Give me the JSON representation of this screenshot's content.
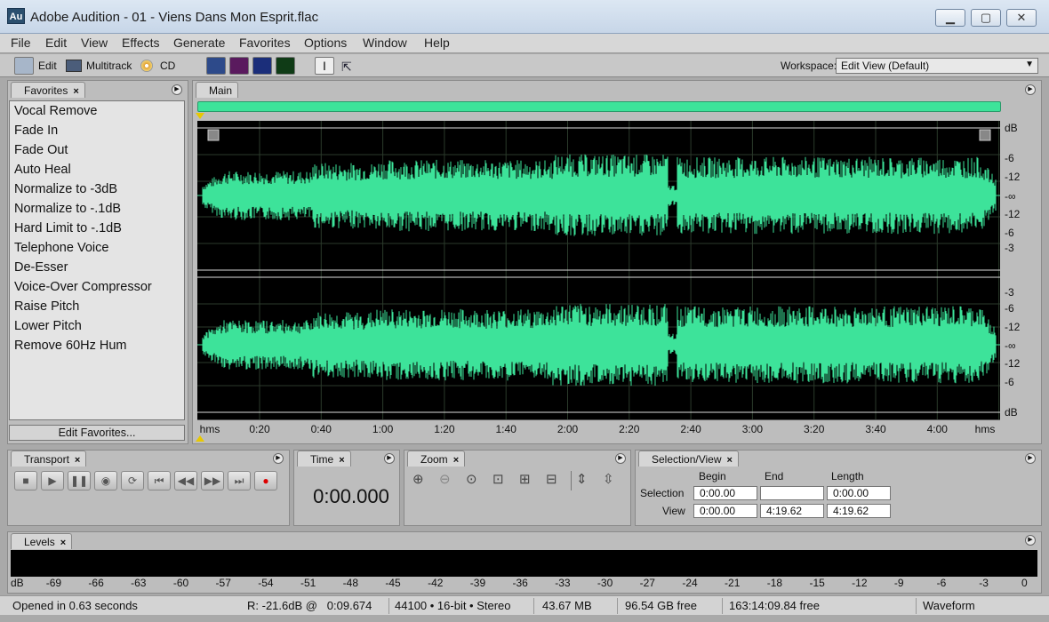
{
  "window": {
    "app_icon": "Au",
    "title": "Adobe Audition - 01 - Viens Dans Mon Esprit.flac"
  },
  "menu": [
    "File",
    "Edit",
    "View",
    "Effects",
    "Generate",
    "Favorites",
    "Options",
    "Window",
    "Help"
  ],
  "toolbar": {
    "edit_label": "Edit",
    "multitrack_label": "Multitrack",
    "cd_label": "CD",
    "workspace_label": "Workspace:",
    "workspace_value": "Edit View (Default)"
  },
  "favorites": {
    "tab": "Favorites",
    "items": [
      "Vocal Remove",
      "Fade In",
      "Fade Out",
      "Auto Heal",
      "Normalize to -3dB",
      "Normalize to -.1dB",
      "Hard Limit to -.1dB",
      "Telephone Voice",
      "De-Esser",
      "Voice-Over Compressor",
      "Raise Pitch",
      "Lower Pitch",
      "Remove 60Hz Hum"
    ],
    "edit_button": "Edit Favorites..."
  },
  "main": {
    "tab": "Main",
    "ruler": {
      "unit_left": "hms",
      "unit_right": "hms",
      "ticks": [
        "0:20",
        "0:40",
        "1:00",
        "1:20",
        "1:40",
        "2:00",
        "2:20",
        "2:40",
        "3:00",
        "3:20",
        "3:40",
        "4:00"
      ]
    },
    "db_labels_top": [
      "dB",
      "-6",
      "-12",
      "-∞",
      "-12",
      "-6",
      "-3"
    ],
    "db_labels_bottom": [
      "-3",
      "-6",
      "-12",
      "-∞",
      "-12",
      "-6",
      "dB"
    ],
    "wave_color": "#3de39a"
  },
  "transport": {
    "tab": "Transport"
  },
  "time": {
    "tab": "Time",
    "value": "0:00.000"
  },
  "zoom": {
    "tab": "Zoom"
  },
  "selection": {
    "tab": "Selection/View",
    "headers": [
      "Begin",
      "End",
      "Length"
    ],
    "rows": [
      {
        "label": "Selection",
        "begin": "0:00.00",
        "end": "",
        "length": "0:00.00"
      },
      {
        "label": "View",
        "begin": "0:00.00",
        "end": "4:19.62",
        "length": "4:19.62"
      }
    ]
  },
  "levels": {
    "tab": "Levels",
    "scale": [
      "dB",
      "-69",
      "-66",
      "-63",
      "-60",
      "-57",
      "-54",
      "-51",
      "-48",
      "-45",
      "-42",
      "-39",
      "-36",
      "-33",
      "-30",
      "-27",
      "-24",
      "-21",
      "-18",
      "-15",
      "-12",
      "-9",
      "-6",
      "-3",
      "0"
    ]
  },
  "status": {
    "opened": "Opened in 0.63 seconds",
    "cursor": "R: -21.6dB @   0:09.674",
    "format": "44100 • 16-bit • Stereo",
    "size": "43.67 MB",
    "free": "96.54 GB free",
    "free_time": "163:14:09.84 free",
    "view_mode": "Waveform"
  }
}
